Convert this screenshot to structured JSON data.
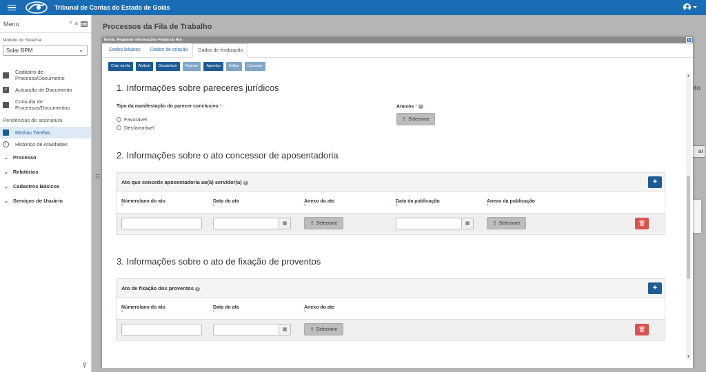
{
  "header": {
    "app_title": "Tribunal de Contas do Estado de Goiás",
    "icons": [
      "menu-icon",
      "user-icon"
    ]
  },
  "sidebar": {
    "menu_label": "Menu",
    "module_label": "Módulo do Sistema:",
    "module_value": "Solar BPM",
    "items": [
      {
        "label": "Cadastro de Processo/Documento",
        "icon": "folder-icon"
      },
      {
        "label": "Autuação de Documento",
        "icon": "check-square-icon"
      },
      {
        "label": "Consulta de Processos/Documentos",
        "icon": "clipboard-icon"
      }
    ],
    "sub_heading": "Pendências de assinatura",
    "tasks": [
      {
        "label": "Minhas Tarefas",
        "icon": "list-icon",
        "active": true
      },
      {
        "label": "Histórico de Atividades",
        "icon": "clock-icon",
        "active": false
      }
    ],
    "groups": [
      "Processo",
      "Relatórios",
      "Cadastros Básicos",
      "Serviços de Usuário"
    ]
  },
  "page": {
    "title": "Processos da Fila de Trabalho",
    "bg_right_text": "nto",
    "bg_bracket_text": "ar"
  },
  "modal": {
    "header_title": "Tarefa: Registrar Informações Finais do Ato",
    "close_label": "x",
    "tabs": [
      "Dados básicos",
      "Dados de criação",
      "Dados de finalização"
    ],
    "active_tab": 2,
    "actions": [
      {
        "label": "Criar tarefa",
        "enabled": true
      },
      {
        "label": "Atribuir",
        "enabled": true
      },
      {
        "label": "Desatribuir",
        "enabled": true
      },
      {
        "label": "Rejeitar",
        "enabled": false
      },
      {
        "label": "Agendar",
        "enabled": true
      },
      {
        "label": "Editar",
        "enabled": false
      },
      {
        "label": "Cancelar",
        "enabled": false
      }
    ],
    "section1": {
      "title": "1. Informações sobre pareceres jurídicos",
      "field_label": "Tipo da manifestação do parecer conclusivo",
      "required_mark": "*",
      "options": [
        "Favorável",
        "Desfavorável"
      ],
      "attach_label": "Anexos",
      "select_label": "Selecione"
    },
    "section2": {
      "title": "2. Informações sobre o ato concessor de aposentadoria",
      "panel_title": "Ato que concede aposentadoria ao(à) servidor(a)",
      "columns": [
        "Número/ano do ato",
        "Data do ato",
        "Anexo do ato",
        "Data da publicação",
        "Anexo da publicação"
      ],
      "select_label": "Selecione"
    },
    "section3": {
      "title": "3. Informações sobre o ato de fixação de proventos",
      "panel_title": "Ato de fixação dos proventos",
      "columns": [
        "Número/ano do ato",
        "Data do ato",
        "Anexo do ato"
      ],
      "select_label": "Selecione"
    },
    "plus_label": "+"
  }
}
